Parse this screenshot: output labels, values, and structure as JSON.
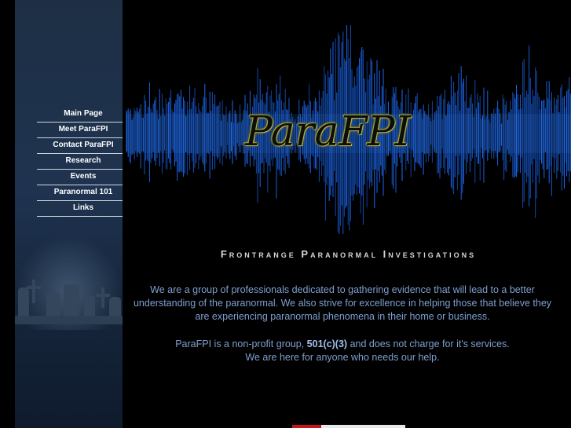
{
  "nav": {
    "items": [
      {
        "label": "Main Page"
      },
      {
        "label": "Meet ParaFPI"
      },
      {
        "label": "Contact ParaFPI"
      },
      {
        "label": "Research"
      },
      {
        "label": "Events"
      },
      {
        "label": "Paranormal 101"
      },
      {
        "label": "Links"
      }
    ]
  },
  "banner": {
    "logo_text": "ParaFPI",
    "wave_color": "#1e6fff"
  },
  "main": {
    "subtitle": "Frontrange Paranormal Investigations",
    "intro": "We are a group of professionals dedicated to gathering evidence that will lead to a better understanding of the paranormal. We also strive for excellence in helping those that believe they are experiencing paranormal phenomena in their home or business.",
    "note_pre": "ParaFPI is a non-profit group, ",
    "note_status": "501(c)(3)",
    "note_post": " and does not charge for it's services.",
    "note_line2": "We are here for anyone who needs our help."
  }
}
